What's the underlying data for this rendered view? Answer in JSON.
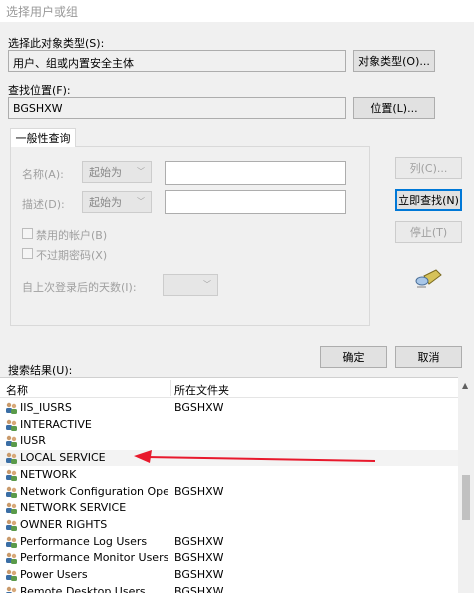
{
  "window": {
    "title": "选择用户或组"
  },
  "object_type": {
    "label": "选择此对象类型(S):",
    "value": "用户、组或内置安全主体",
    "button": "对象类型(O)..."
  },
  "location": {
    "label": "查找位置(F):",
    "value": "BGSHXW",
    "button": "位置(L)..."
  },
  "query": {
    "tab": "一般性查询",
    "name_label": "名称(A):",
    "name_combo": "起始为",
    "desc_label": "描述(D):",
    "desc_combo": "起始为",
    "disabled_accounts": "禁用的帐户(B)",
    "no_expire_pwd": "不过期密码(X)",
    "days_label": "自上次登录后的天数(I):"
  },
  "side_buttons": {
    "columns": "列(C)...",
    "find_now": "立即查找(N)",
    "stop": "停止(T)"
  },
  "ok": "确定",
  "cancel": "取消",
  "results": {
    "label": "搜索结果(U):",
    "col_name": "名称",
    "col_folder": "所在文件夹",
    "rows": [
      {
        "name": "IIS_IUSRS",
        "folder": "BGSHXW"
      },
      {
        "name": "INTERACTIVE",
        "folder": ""
      },
      {
        "name": "IUSR",
        "folder": ""
      },
      {
        "name": "LOCAL SERVICE",
        "folder": ""
      },
      {
        "name": "NETWORK",
        "folder": ""
      },
      {
        "name": "Network Configuration Operat...",
        "folder": "BGSHXW"
      },
      {
        "name": "NETWORK SERVICE",
        "folder": ""
      },
      {
        "name": "OWNER RIGHTS",
        "folder": ""
      },
      {
        "name": "Performance Log Users",
        "folder": "BGSHXW"
      },
      {
        "name": "Performance Monitor Users",
        "folder": "BGSHXW"
      },
      {
        "name": "Power Users",
        "folder": "BGSHXW"
      },
      {
        "name": "Remote Desktop Users",
        "folder": "BGSHXW"
      }
    ]
  },
  "colors": {
    "annotation_arrow": "#e8192c",
    "focus_border": "#0078d7"
  }
}
